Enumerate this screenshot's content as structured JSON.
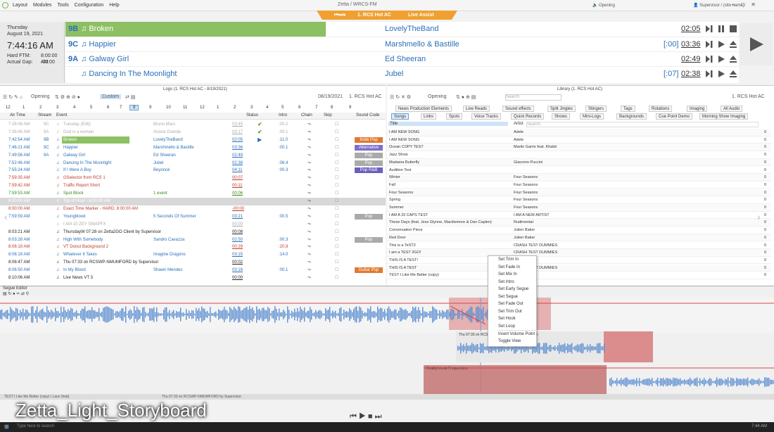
{
  "menu": {
    "items": [
      "Layout",
      "Modules",
      "Tools",
      "Configuration",
      "Help"
    ]
  },
  "window": {
    "title": "Zetta / WRCS-FM",
    "opening": "Opening",
    "user": "Supervisor / (site name)"
  },
  "stationbar": {
    "station": "1. RCS Hot AC",
    "mode": "Live Assist"
  },
  "clock": {
    "day": "Thursday",
    "date": "August 19, 2021",
    "time": "7:44:16 AM",
    "hard_ftm_label": "Hard FTM:",
    "hard_ftm_value": "8:00:00 AM",
    "actual_gap_label": "Actual Gap:",
    "actual_gap_value": "-00:00"
  },
  "playlist": [
    {
      "slot": "9B",
      "title": "Broken",
      "artist": "LovelyTheBand",
      "pre": "",
      "duration": "02:05"
    },
    {
      "slot": "9C",
      "title": "Happier",
      "artist": "Marshmello & Bastille",
      "pre": "[:00]",
      "duration": "03:36"
    },
    {
      "slot": "9A",
      "title": "Galway Girl",
      "artist": "Ed Sheeran",
      "pre": "",
      "duration": "02:49"
    },
    {
      "slot": "",
      "title": "Dancing In The Moonlight",
      "artist": "Jubel",
      "pre": "[:07]",
      "duration": "02:38"
    }
  ],
  "logs": {
    "title": "Logs (1. RCS Hot AC - 8/19/2021)",
    "opening": "Opening",
    "custom": "Custom",
    "date": "08/19/2021",
    "station": "1. RCS Hot AC",
    "hours": [
      "12",
      "1",
      "2",
      "3",
      "4",
      "5",
      "6",
      "7",
      "8",
      "9",
      "10",
      "11",
      "12",
      "1",
      "2",
      "3",
      "4",
      "5",
      "6",
      "7",
      "8",
      "9"
    ],
    "columns": [
      "Air Time",
      "Stream",
      "Event",
      "Status",
      "Intro",
      "Chain",
      "Skip",
      "Sound Code"
    ],
    "rows": [
      {
        "time": "7:26:06 AM",
        "slot": "9C",
        "event": "Tuesday (Edit)",
        "artist": "Bruno Mars",
        "len": "03:45",
        "intro": ":00.2",
        "code": "",
        "cls": "past"
      },
      {
        "time": "7:38:46 AM",
        "slot": "9A",
        "event": "God is a woman",
        "artist": "Ariana Grande",
        "len": "03:17",
        "intro": ":00.1",
        "code": "",
        "cls": "past"
      },
      {
        "time": "7:42:54 AM",
        "slot": "9B",
        "event": "Broken",
        "artist": "LovelyTheBand",
        "len": "02:05",
        "intro": ":11.0",
        "code": "Indie Pop",
        "cls": ""
      },
      {
        "time": "7:46:21 AM",
        "slot": "9C",
        "event": "Happier",
        "artist": "Marshmello & Bastille",
        "len": "03:36",
        "intro": ":00.1",
        "code": "Alternative",
        "cls": ""
      },
      {
        "time": "7:49:56 AM",
        "slot": "9A",
        "event": "Galway Girl",
        "artist": "Ed Sheeran",
        "len": "02:49",
        "intro": "",
        "code": "Pop",
        "cls": ""
      },
      {
        "time": "7:52:46 AM",
        "slot": "",
        "event": "Dancing In The Moonlight",
        "artist": "Jubel",
        "len": "02:38",
        "intro": ":06.4",
        "code": "Pop",
        "cls": ""
      },
      {
        "time": "7:55:24 AM",
        "slot": "",
        "event": "If I Were A Boy",
        "artist": "Beyoncé",
        "len": "04:11",
        "intro": ":00.3",
        "code": "Pop R&B",
        "cls": ""
      },
      {
        "time": "7:59:35 AM",
        "slot": "",
        "event": "GSelector from RCS 1",
        "artist": "",
        "len": "00:07",
        "intro": "",
        "code": "",
        "cls": "red"
      },
      {
        "time": "7:59:42 AM",
        "slot": "",
        "event": "Traffic Report Short",
        "artist": "",
        "len": "00:11",
        "intro": "",
        "code": "",
        "cls": "red"
      },
      {
        "time": "7:59:53 AM",
        "slot": "",
        "event": "Spot Block",
        "artist": "1 event",
        "len": "00:06",
        "intro": "",
        "code": "",
        "cls": "green"
      },
      {
        "time": "8:00:00 AM",
        "slot": "",
        "event": "Top of Hour - 8:00:00 AM",
        "artist": "",
        "len": "",
        "intro": "",
        "code": "",
        "cls": "grey"
      },
      {
        "time": "8:00:00 AM",
        "slot": "",
        "event": "Exact Time Marker - HARD: 8:00:00 AM",
        "artist": "",
        "len": "-00:00",
        "intro": "",
        "code": "",
        "cls": "red"
      },
      {
        "time": "7:59:59 AM",
        "slot": "",
        "event": "Youngblood",
        "artist": "5 Seconds Of Summer",
        "len": "03:21",
        "intro": ":00.5",
        "code": "Pop",
        "cls": ""
      },
      {
        "time": "",
        "slot": "",
        "event": "I AM 10 ZEY SWAPFX",
        "artist": "",
        "len": "00:00",
        "intro": "",
        "code": "",
        "cls": "past"
      },
      {
        "time": "8:03:21 AM",
        "slot": "",
        "event": "ThursdayW 07:28 on Zetta2GO Client by Supervisor",
        "artist": "",
        "len": "00:08",
        "intro": "",
        "code": "",
        "cls": "black"
      },
      {
        "time": "8:03:28 AM",
        "slot": "",
        "event": "High With Somebody",
        "artist": "Sandro Cavazza",
        "len": "02:50",
        "intro": ":00.3",
        "code": "Pop",
        "cls": ""
      },
      {
        "time": "8:06:19 AM",
        "slot": "",
        "event": "VT Donut Background 2",
        "artist": "",
        "len": "00:29",
        "intro": ":20.8",
        "code": "",
        "cls": "red"
      },
      {
        "time": "8:06:19 AM",
        "slot": "",
        "event": "Whatever It Takes",
        "artist": "Imagine Dragons",
        "len": "03:15",
        "intro": ":14.0",
        "code": "",
        "cls": ""
      },
      {
        "time": "8:06:47 AM",
        "slot": "",
        "event": "Thu 07:33 on RCSWP-NMUMFORD by Supervisor",
        "artist": "",
        "len": "00:02",
        "intro": "",
        "code": "",
        "cls": "black"
      },
      {
        "time": "8:06:50 AM",
        "slot": "",
        "event": "In My Blood",
        "artist": "Shawn Mendes",
        "len": "03:16",
        "intro": ":00.1",
        "code": "Guitar Pop",
        "cls": ""
      },
      {
        "time": "8:10:06 AM",
        "slot": "",
        "event": "Live News VT 3",
        "artist": "",
        "len": "00:00",
        "intro": "",
        "code": "",
        "cls": "black"
      }
    ]
  },
  "library": {
    "title": "Library (1. RCS Hot AC)",
    "opening": "Opening",
    "search_placeholder": "Search",
    "station": "1. RCS Hot AC",
    "tabs_row1": [
      "News Production Elements",
      "Live Reads",
      "Sound effects",
      "Split Jingles",
      "Stingers",
      "Tags",
      "Rotations",
      "Imaging",
      "All Audio"
    ],
    "tabs_row2": [
      "Songs",
      "Links",
      "Spots",
      "Voice Tracks",
      "Quick Records",
      "Shows",
      "Mini-Logs",
      "Backgrounds",
      "Cue Point Demo",
      "Morning Show Imaging"
    ],
    "col_title": "Title",
    "col_artist": "Artist",
    "artist_search": "Search",
    "rows": [
      {
        "title": "I AM NEW SONG",
        "artist": "Adele"
      },
      {
        "title": "I AM NEW SONG",
        "artist": "Adele"
      },
      {
        "title": "Ocean COPY TEST",
        "artist": "Martin Garrix feat. Khalid"
      },
      {
        "title": "Jazz Show",
        "artist": ""
      },
      {
        "title": "Madama Butterfly",
        "artist": "Giacomo Puccini"
      },
      {
        "title": "Audition Test",
        "artist": ""
      },
      {
        "title": "Winter",
        "artist": "Four Seasons"
      },
      {
        "title": "Fall",
        "artist": "Four Seasons"
      },
      {
        "title": "Four Seasons",
        "artist": "Four Seasons"
      },
      {
        "title": "Spring",
        "artist": "Four Seasons"
      },
      {
        "title": "Summer",
        "artist": "Four Seasons"
      },
      {
        "title": "I AM A 33 CAPS TEST",
        "artist": "I AM A NEW ARTIST"
      },
      {
        "title": "These Days (feat. Jess Glynne, Macklemore & Dan Caplen)",
        "artist": "Rudimental"
      },
      {
        "title": "Conversation Piece",
        "artist": "Julien Baker"
      },
      {
        "title": "Red Door",
        "artist": "Julien Baker"
      },
      {
        "title": "This is a TeST2",
        "artist": "CRASH TEST DUMMIES"
      },
      {
        "title": "I am a TEST 2GO!",
        "artist": "CRASH TEST DUMMIES"
      },
      {
        "title": "THIS IS A TEST!",
        "artist": ""
      },
      {
        "title": "THIS IS A TEST",
        "artist": "CRASH TEST DUMMIES"
      },
      {
        "title": "TEST I Like Me Better (copy)",
        "artist": ""
      }
    ]
  },
  "context_menu": [
    "Set Trim In",
    "Set Fade In",
    "Set Mix In",
    "Set Intro",
    "Set Early Segue",
    "Set Segue",
    "Set Fade Out",
    "Set Trim Out",
    "Set Hook",
    "Set Loop",
    "Insert Volume Point",
    "Toggle View"
  ],
  "segue": {
    "label": "Segue Editor",
    "clip2": "Thu 07:33 on RCSWP-NMUMFORD by Supervisor",
    "clip3": "Reality's Lost Frequencies",
    "bottom_clip1": "TEST I Like Me Better (copy) / Lauv (feat)",
    "bottom_clip2": "Thu 07:33 on RCSWP-NMUMFORD by Supervisor"
  },
  "caption": "Zetta_Light_Storyboard",
  "taskbar": {
    "search": "Type here to search",
    "time": "7:44 AM"
  },
  "colors": {
    "accent": "#2a6fb8",
    "green": "#8cc063",
    "orange": "#f0a030",
    "red": "#c0392b"
  }
}
